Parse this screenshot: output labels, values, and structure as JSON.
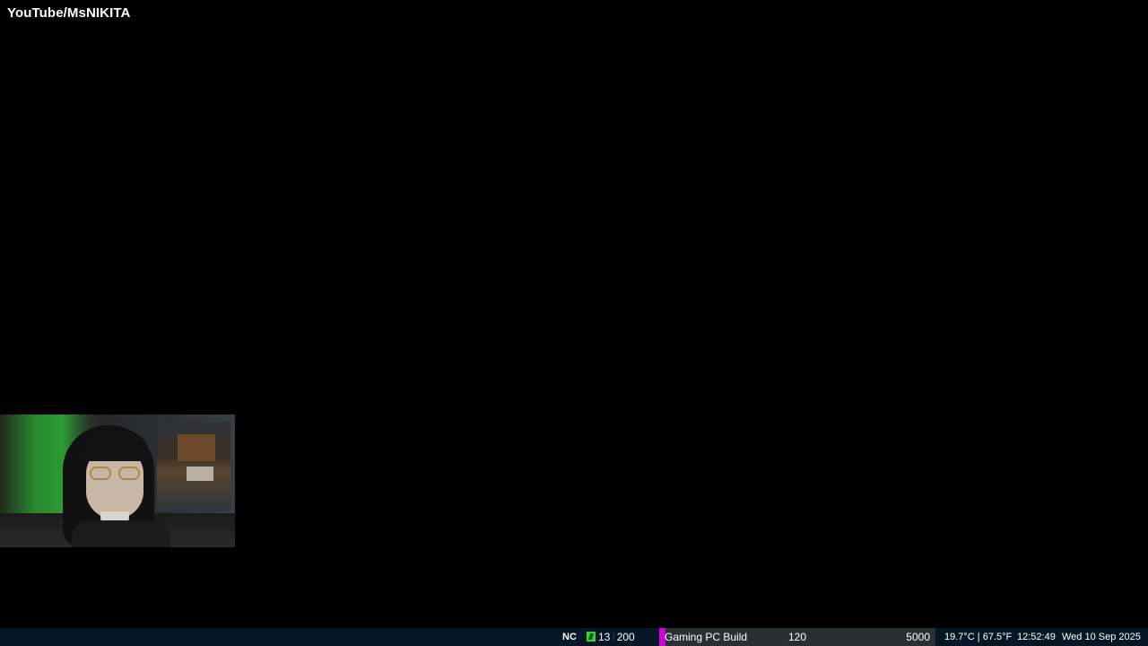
{
  "overlay": {
    "channel": "YouTube/MsNIKITA"
  },
  "statusbar": {
    "nc_label": "NC",
    "counter": {
      "icon": "green-flag-icon",
      "current": "13",
      "separator": "/",
      "total": "200"
    },
    "goal": {
      "name": "Gaming PC Build",
      "current": "120",
      "target": "5000",
      "progress_fraction": 0.024,
      "fill_color": "#d000d8"
    },
    "weather": "19.7°C | 67.5°F",
    "time": "12:52:49",
    "date": "Wed 10 Sep 2025"
  },
  "colors": {
    "background": "#000000",
    "statusbar_bg": "#061624",
    "counter_icon": "#2fd63a",
    "goal_bg": "#2a2f33"
  }
}
